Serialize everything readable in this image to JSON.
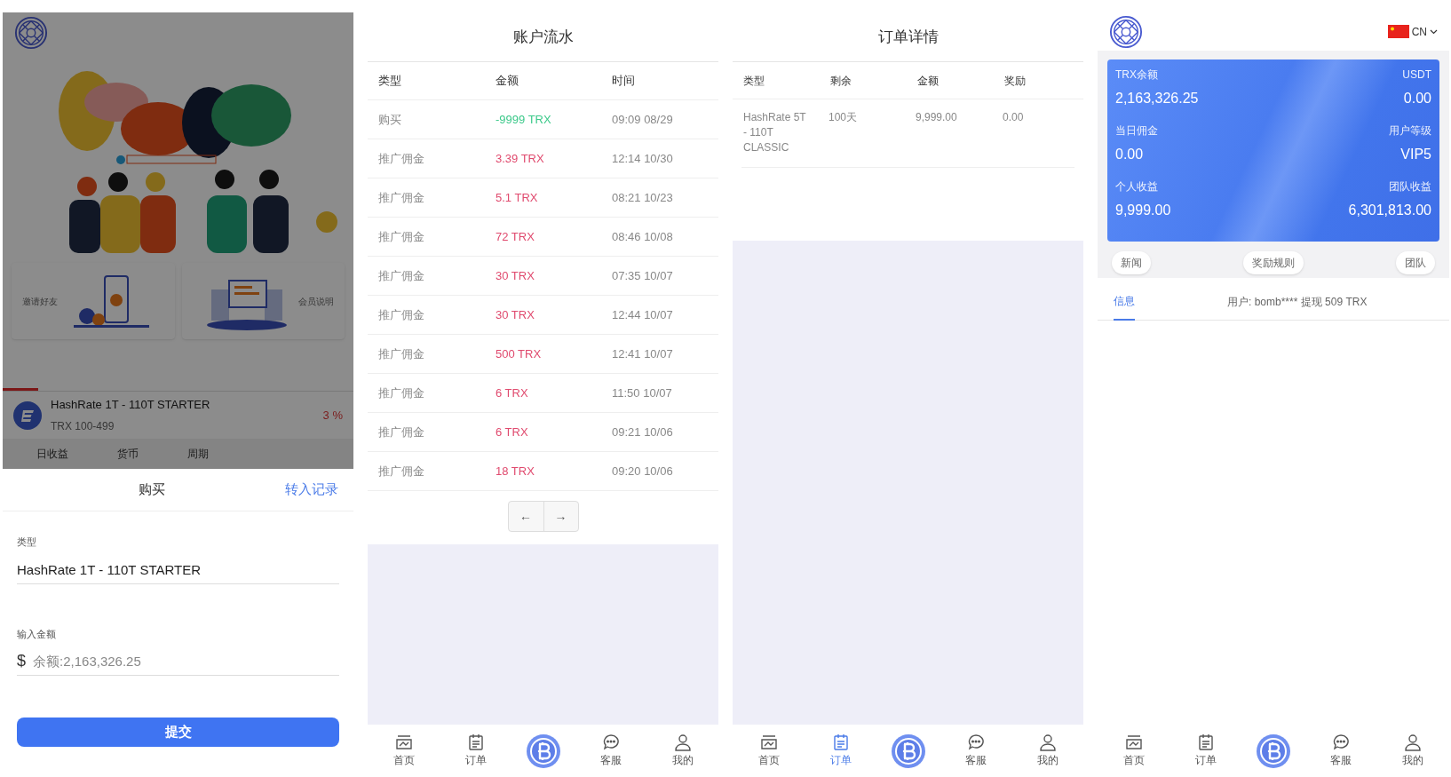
{
  "home_screen": {
    "feature_cards": [
      {
        "label": "邀请好友"
      },
      {
        "label": "会员说明"
      }
    ],
    "carousel_progress": {
      "level": 0.1
    },
    "product": {
      "name": "HashRate 1T - 110T STARTER",
      "range": "TRX 100-499",
      "rate": "3 %"
    },
    "tabs": [
      "日收益",
      "货币",
      "周期"
    ]
  },
  "purchase_sheet": {
    "title": "购买",
    "link": "转入记录",
    "fields": [
      {
        "label": "类型",
        "value": "HashRate 1T - 110T STARTER"
      },
      {
        "label": "输入金额",
        "prefix": "$",
        "placeholder": "余额:2,163,326.25"
      }
    ],
    "submit": "提交"
  },
  "ledger_screen": {
    "title": "账户流水",
    "columns": [
      "类型",
      "金额",
      "时间"
    ],
    "rows": [
      {
        "type": "购买",
        "amount": "-9999 TRX",
        "time": "09:09 08/29",
        "color": "#3cc98a"
      },
      {
        "type": "推广佣金",
        "amount": "3.39 TRX",
        "time": "12:14 10/30",
        "color": "#e04a6e"
      },
      {
        "type": "推广佣金",
        "amount": "5.1 TRX",
        "time": "08:21 10/23",
        "color": "#e04a6e"
      },
      {
        "type": "推广佣金",
        "amount": "72 TRX",
        "time": "08:46 10/08",
        "color": "#e04a6e"
      },
      {
        "type": "推广佣金",
        "amount": "30 TRX",
        "time": "07:35 10/07",
        "color": "#e04a6e"
      },
      {
        "type": "推广佣金",
        "amount": "30 TRX",
        "time": "12:44 10/07",
        "color": "#e04a6e"
      },
      {
        "type": "推广佣金",
        "amount": "500 TRX",
        "time": "12:41 10/07",
        "color": "#e04a6e"
      },
      {
        "type": "推广佣金",
        "amount": "6 TRX",
        "time": "11:50 10/07",
        "color": "#e04a6e"
      },
      {
        "type": "推广佣金",
        "amount": "6 TRX",
        "time": "09:21 10/06",
        "color": "#e04a6e"
      },
      {
        "type": "推广佣金",
        "amount": "18 TRX",
        "time": "09:20 10/06",
        "color": "#e04a6e"
      }
    ],
    "pager": [
      "←",
      "→"
    ],
    "bottom_nav": [
      {
        "kind": "tab",
        "label": "首页",
        "selected": false
      },
      {
        "kind": "tab",
        "label": "订单",
        "selected": false
      },
      {
        "kind": "center"
      },
      {
        "kind": "tab",
        "label": "客服",
        "selected": false
      },
      {
        "kind": "tab",
        "label": "我的",
        "selected": false
      }
    ]
  },
  "order_screen": {
    "title": "订单详情",
    "columns": [
      "类型",
      "剩余",
      "金额",
      "奖励"
    ],
    "rows": [
      [
        "HashRate 5T - 110T CLASSIC",
        "100天",
        "9,999.00",
        "0.00"
      ]
    ],
    "bottom_nav": [
      {
        "kind": "tab",
        "label": "首页",
        "selected": false
      },
      {
        "kind": "tab",
        "label": "订单",
        "selected": true
      },
      {
        "kind": "center"
      },
      {
        "kind": "tab",
        "label": "客服",
        "selected": false
      },
      {
        "kind": "tab",
        "label": "我的",
        "selected": false
      }
    ]
  },
  "account_screen": {
    "language": "CN",
    "stats": [
      {
        "label": "TRX余额",
        "value": "2,163,326.25"
      },
      {
        "label": "USDT",
        "value": "0.00"
      },
      {
        "label": "当日佣金",
        "value": "0.00"
      },
      {
        "label": "用户等级",
        "value": "VIP5"
      },
      {
        "label": "个人收益",
        "value": "9,999.00"
      },
      {
        "label": "团队收益",
        "value": "6,301,813.00"
      }
    ],
    "buttons": [
      "新闻",
      "奖励规则",
      "团队"
    ],
    "notice_tab": {
      "label": "信息",
      "selected": true
    },
    "notice": "用户: bomb**** 提现 509 TRX",
    "bottom_nav": [
      {
        "kind": "tab",
        "label": "首页",
        "selected": false
      },
      {
        "kind": "tab",
        "label": "订单",
        "selected": false
      },
      {
        "kind": "center"
      },
      {
        "kind": "tab",
        "label": "客服",
        "selected": false
      },
      {
        "kind": "tab",
        "label": "我的",
        "selected": false
      }
    ]
  }
}
